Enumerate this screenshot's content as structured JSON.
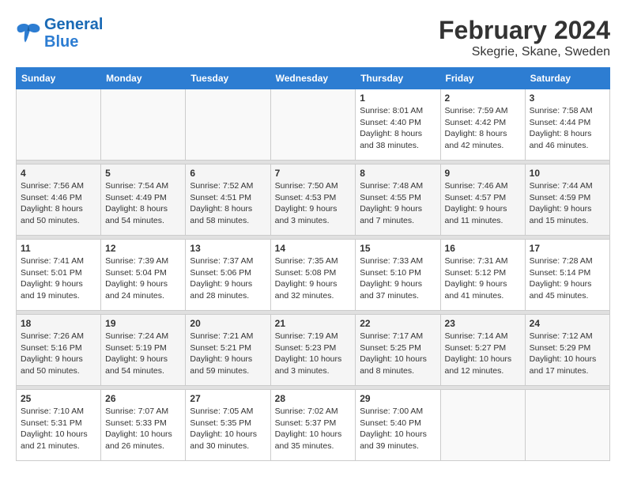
{
  "logo": {
    "line1": "General",
    "line2": "Blue"
  },
  "title": "February 2024",
  "subtitle": "Skegrie, Skane, Sweden",
  "weekdays": [
    "Sunday",
    "Monday",
    "Tuesday",
    "Wednesday",
    "Thursday",
    "Friday",
    "Saturday"
  ],
  "weeks": [
    [
      {
        "day": "",
        "info": ""
      },
      {
        "day": "",
        "info": ""
      },
      {
        "day": "",
        "info": ""
      },
      {
        "day": "",
        "info": ""
      },
      {
        "day": "1",
        "info": "Sunrise: 8:01 AM\nSunset: 4:40 PM\nDaylight: 8 hours\nand 38 minutes."
      },
      {
        "day": "2",
        "info": "Sunrise: 7:59 AM\nSunset: 4:42 PM\nDaylight: 8 hours\nand 42 minutes."
      },
      {
        "day": "3",
        "info": "Sunrise: 7:58 AM\nSunset: 4:44 PM\nDaylight: 8 hours\nand 46 minutes."
      }
    ],
    [
      {
        "day": "4",
        "info": "Sunrise: 7:56 AM\nSunset: 4:46 PM\nDaylight: 8 hours\nand 50 minutes."
      },
      {
        "day": "5",
        "info": "Sunrise: 7:54 AM\nSunset: 4:49 PM\nDaylight: 8 hours\nand 54 minutes."
      },
      {
        "day": "6",
        "info": "Sunrise: 7:52 AM\nSunset: 4:51 PM\nDaylight: 8 hours\nand 58 minutes."
      },
      {
        "day": "7",
        "info": "Sunrise: 7:50 AM\nSunset: 4:53 PM\nDaylight: 9 hours\nand 3 minutes."
      },
      {
        "day": "8",
        "info": "Sunrise: 7:48 AM\nSunset: 4:55 PM\nDaylight: 9 hours\nand 7 minutes."
      },
      {
        "day": "9",
        "info": "Sunrise: 7:46 AM\nSunset: 4:57 PM\nDaylight: 9 hours\nand 11 minutes."
      },
      {
        "day": "10",
        "info": "Sunrise: 7:44 AM\nSunset: 4:59 PM\nDaylight: 9 hours\nand 15 minutes."
      }
    ],
    [
      {
        "day": "11",
        "info": "Sunrise: 7:41 AM\nSunset: 5:01 PM\nDaylight: 9 hours\nand 19 minutes."
      },
      {
        "day": "12",
        "info": "Sunrise: 7:39 AM\nSunset: 5:04 PM\nDaylight: 9 hours\nand 24 minutes."
      },
      {
        "day": "13",
        "info": "Sunrise: 7:37 AM\nSunset: 5:06 PM\nDaylight: 9 hours\nand 28 minutes."
      },
      {
        "day": "14",
        "info": "Sunrise: 7:35 AM\nSunset: 5:08 PM\nDaylight: 9 hours\nand 32 minutes."
      },
      {
        "day": "15",
        "info": "Sunrise: 7:33 AM\nSunset: 5:10 PM\nDaylight: 9 hours\nand 37 minutes."
      },
      {
        "day": "16",
        "info": "Sunrise: 7:31 AM\nSunset: 5:12 PM\nDaylight: 9 hours\nand 41 minutes."
      },
      {
        "day": "17",
        "info": "Sunrise: 7:28 AM\nSunset: 5:14 PM\nDaylight: 9 hours\nand 45 minutes."
      }
    ],
    [
      {
        "day": "18",
        "info": "Sunrise: 7:26 AM\nSunset: 5:16 PM\nDaylight: 9 hours\nand 50 minutes."
      },
      {
        "day": "19",
        "info": "Sunrise: 7:24 AM\nSunset: 5:19 PM\nDaylight: 9 hours\nand 54 minutes."
      },
      {
        "day": "20",
        "info": "Sunrise: 7:21 AM\nSunset: 5:21 PM\nDaylight: 9 hours\nand 59 minutes."
      },
      {
        "day": "21",
        "info": "Sunrise: 7:19 AM\nSunset: 5:23 PM\nDaylight: 10 hours\nand 3 minutes."
      },
      {
        "day": "22",
        "info": "Sunrise: 7:17 AM\nSunset: 5:25 PM\nDaylight: 10 hours\nand 8 minutes."
      },
      {
        "day": "23",
        "info": "Sunrise: 7:14 AM\nSunset: 5:27 PM\nDaylight: 10 hours\nand 12 minutes."
      },
      {
        "day": "24",
        "info": "Sunrise: 7:12 AM\nSunset: 5:29 PM\nDaylight: 10 hours\nand 17 minutes."
      }
    ],
    [
      {
        "day": "25",
        "info": "Sunrise: 7:10 AM\nSunset: 5:31 PM\nDaylight: 10 hours\nand 21 minutes."
      },
      {
        "day": "26",
        "info": "Sunrise: 7:07 AM\nSunset: 5:33 PM\nDaylight: 10 hours\nand 26 minutes."
      },
      {
        "day": "27",
        "info": "Sunrise: 7:05 AM\nSunset: 5:35 PM\nDaylight: 10 hours\nand 30 minutes."
      },
      {
        "day": "28",
        "info": "Sunrise: 7:02 AM\nSunset: 5:37 PM\nDaylight: 10 hours\nand 35 minutes."
      },
      {
        "day": "29",
        "info": "Sunrise: 7:00 AM\nSunset: 5:40 PM\nDaylight: 10 hours\nand 39 minutes."
      },
      {
        "day": "",
        "info": ""
      },
      {
        "day": "",
        "info": ""
      }
    ]
  ]
}
